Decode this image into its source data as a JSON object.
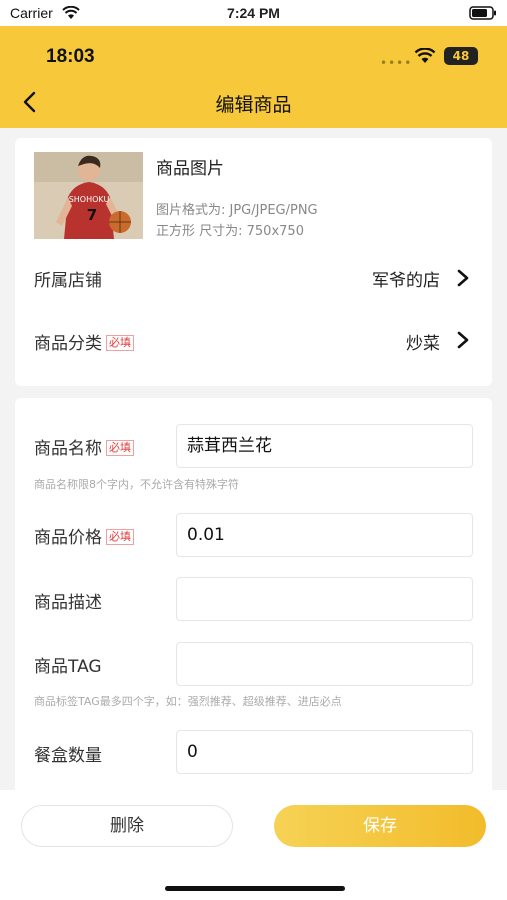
{
  "system_bar": {
    "carrier": "Carrier",
    "time": "7:24 PM"
  },
  "inner_status": {
    "time": "18:03",
    "battery": "48"
  },
  "header": {
    "title": "编辑商品"
  },
  "image_section": {
    "label": "商品图片",
    "format_hint": "图片格式为: JPG/JPEG/PNG",
    "size_hint": "正方形 尺寸为: 750x750",
    "jersey_text": "SHOHOKU",
    "jersey_number": "7"
  },
  "store": {
    "label": "所属店铺",
    "value": "军爷的店"
  },
  "category": {
    "label": "商品分类",
    "required": "必填",
    "value": "炒菜"
  },
  "form": {
    "name": {
      "label": "商品名称",
      "required": "必填",
      "value": "蒜茸西兰花",
      "hint": "商品名称限8个字内，不允许含有特殊字符"
    },
    "price": {
      "label": "商品价格",
      "required": "必填",
      "value": "0.01"
    },
    "description": {
      "label": "商品描述",
      "value": ""
    },
    "tag": {
      "label": "商品TAG",
      "value": "",
      "hint": "商品标签TAG最多四个字，如：强烈推荐、超级推荐、进店必点"
    },
    "box_count": {
      "label": "餐盒数量",
      "value": "0"
    }
  },
  "actions": {
    "delete": "删除",
    "save": "保存"
  },
  "colors": {
    "accent": "#f7c93a",
    "required": "#e23b3b"
  }
}
